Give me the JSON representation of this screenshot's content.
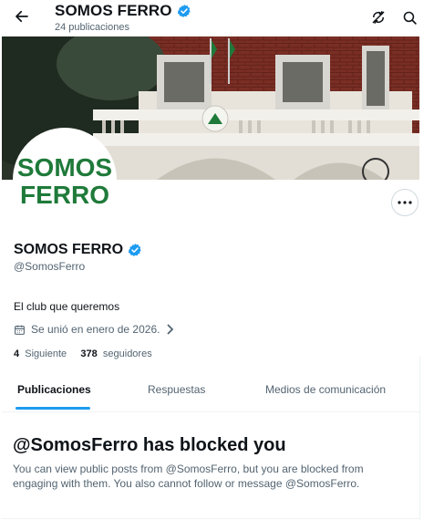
{
  "topbar": {
    "title": "SOMOS FERRO",
    "subtitle": "24 publicaciones"
  },
  "profile": {
    "avatar_text_line1": "SOMOS",
    "avatar_text_line2": "FERRO",
    "name": "SOMOS FERRO",
    "handle": "@SomosFerro",
    "bio": "El club que queremos",
    "joined": "Se unió en enero de 2026.",
    "following_count": "4",
    "following_label": "Siguiente",
    "followers_count": "378",
    "followers_label": "seguidores"
  },
  "tabs": [
    {
      "label": "Publicaciones"
    },
    {
      "label": "Respuestas"
    },
    {
      "label": "Medios de comunicación"
    }
  ],
  "blocked": {
    "title": "@SomosFerro has blocked you",
    "message": "You can view public posts from @SomosFerro, but you are blocked from engaging with them. You also cannot follow or message @SomosFerro."
  },
  "colors": {
    "accent": "#1d9bf0",
    "brand_green": "#1f7a3a",
    "verified": "#1d9bf0"
  },
  "icons": [
    "back-arrow-icon",
    "verified-icon",
    "unblock-sync-icon",
    "search-icon",
    "more-icon",
    "calendar-icon",
    "chevron-right-icon"
  ]
}
